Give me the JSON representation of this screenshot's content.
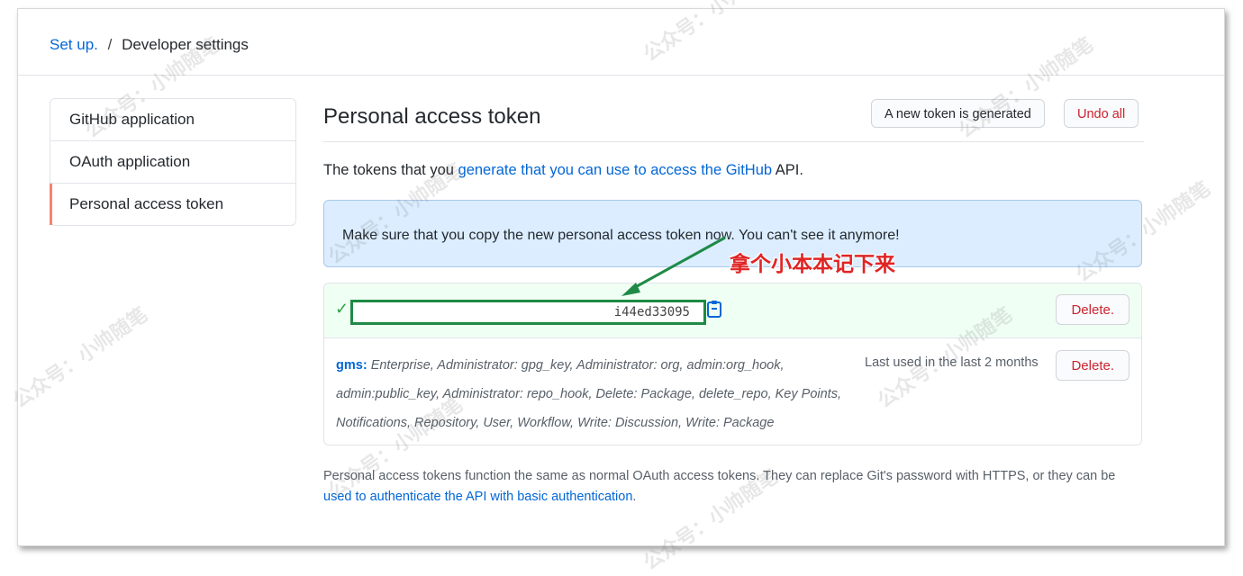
{
  "breadcrumb": {
    "root": "Set up.",
    "separator": "/",
    "current": "Developer settings"
  },
  "sidebar": {
    "items": [
      {
        "label": "GitHub application"
      },
      {
        "label": "OAuth application"
      },
      {
        "label": "Personal access token"
      }
    ]
  },
  "main": {
    "title": "Personal access token",
    "new_token_button": "A new token is generated",
    "undo_button": "Undo all",
    "desc_prefix": "The tokens that you ",
    "desc_link": "generate that you can use to access the GitHub",
    "desc_suffix": " API.",
    "flash": "Make sure that you copy the new personal access token now. You can't see it anymore!",
    "new_token": {
      "code": "i44ed33095",
      "delete": "Delete."
    },
    "token": {
      "name": "gms:",
      "scopes": "Enterprise, Administrator: gpg_key, Administrator: org, admin:org_hook, admin:public_key, Administrator: repo_hook, Delete: Package, delete_repo, Key Points, Notifications, Repository, User, Workflow, Write: Discussion, Write: Package",
      "last_used": "Last used in the last 2 months",
      "delete": "Delete."
    },
    "footnote_text": "Personal access tokens function the same as normal OAuth access tokens. They can replace Git's password with HTTPS, or they can be ",
    "footnote_link": "used to authenticate the API with basic authentication",
    "footnote_end": "."
  },
  "annotation": {
    "text": "拿个小本本记下来"
  },
  "watermark": "公众号：小帅随笔",
  "colors": {
    "link": "#0366d6",
    "danger": "#cb2431",
    "selected_bar": "#f9826c",
    "flash_bg": "#dbedff",
    "success_bg": "#f0fff4",
    "annotation_green": "#1e8a46",
    "annotation_red": "#e02424"
  }
}
